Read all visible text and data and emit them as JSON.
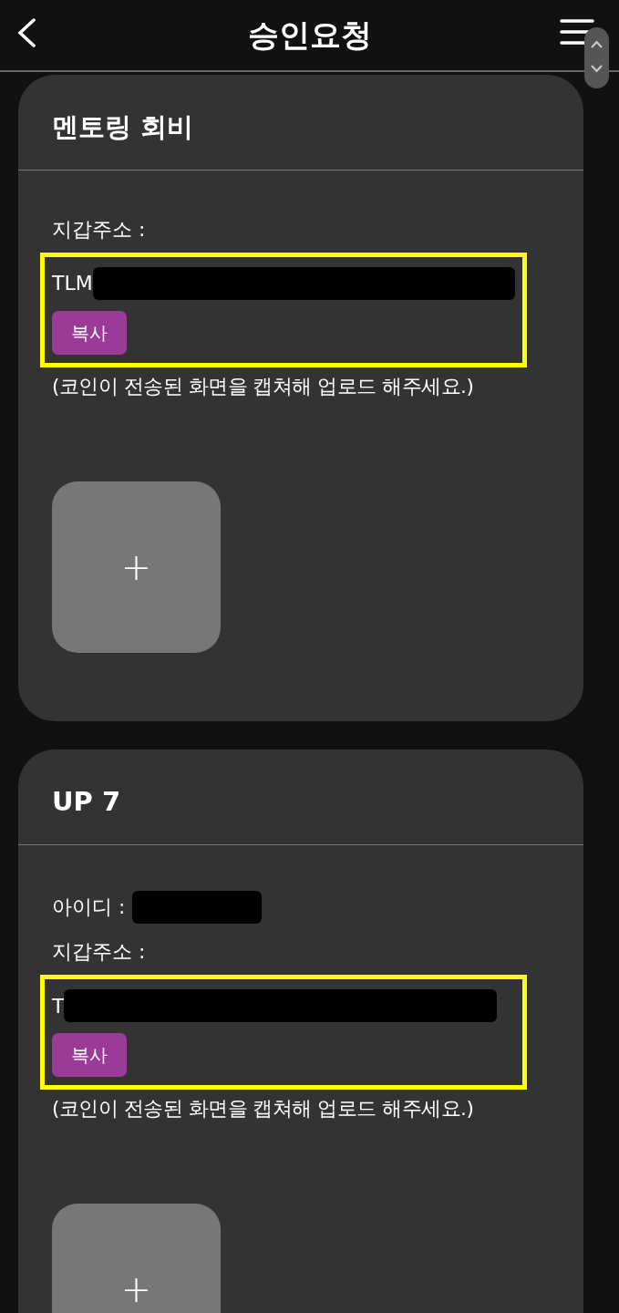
{
  "header": {
    "title": "승인요청"
  },
  "cards": [
    {
      "title": "멘토링 회비",
      "fields": [
        {
          "kind": "address",
          "label": "지갑주소 :",
          "value": "TLM",
          "button": "복사",
          "highlighted": true
        }
      ],
      "note": "(코인이 전송된 화면을 캡쳐해 업로드 해주세요.)",
      "upload": {
        "symbol": "+"
      }
    },
    {
      "title": "UP 7",
      "fields": [
        {
          "kind": "id",
          "label": "아이디 :"
        },
        {
          "kind": "address",
          "label": "지갑주소 :",
          "value": "T",
          "button": "복사",
          "highlighted": true
        }
      ],
      "note": "(코인이 전송된 화면을 캡쳐해 업로드 해주세요.)",
      "upload": {
        "symbol": "+"
      }
    }
  ]
}
